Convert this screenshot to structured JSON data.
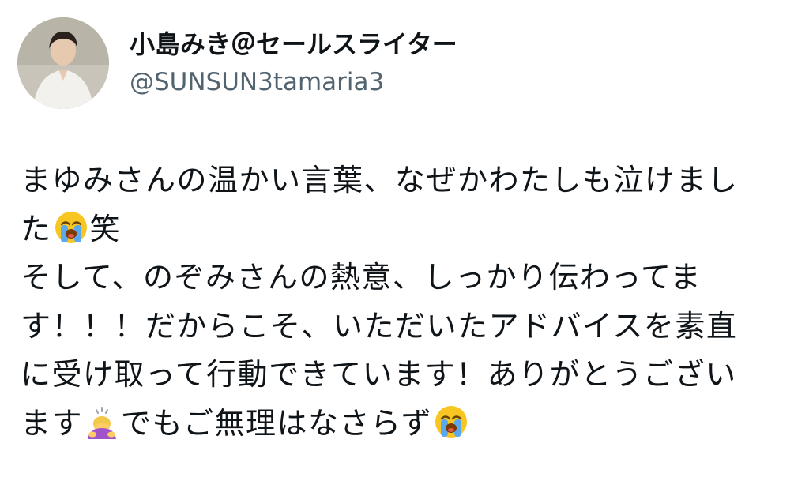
{
  "post": {
    "author": {
      "display_name": "小島みき＠セールスライター",
      "handle": "@SUNSUN3tamaria3"
    },
    "lines": [
      {
        "before": "まゆみさんの温かい言葉、なぜかわたしも泣けまし",
        "after": ""
      },
      {
        "before": "た",
        "after": "笑"
      },
      {
        "before": "そして、のぞみさんの熱意、しっかり伝わってま",
        "after": ""
      },
      {
        "before": "す！！！だからこそ、いただいたアドバイスを素直",
        "after": ""
      },
      {
        "before": "に受け取って行動できています！ありがとうござい",
        "after": ""
      },
      {
        "before": "ます",
        "after": "でもご無理はなさらず"
      }
    ],
    "emoji": {
      "line2": "loudly-crying-face-emoji",
      "line6_mid": "person-bowing-emoji",
      "line6_end": "loudly-crying-face-emoji"
    }
  }
}
